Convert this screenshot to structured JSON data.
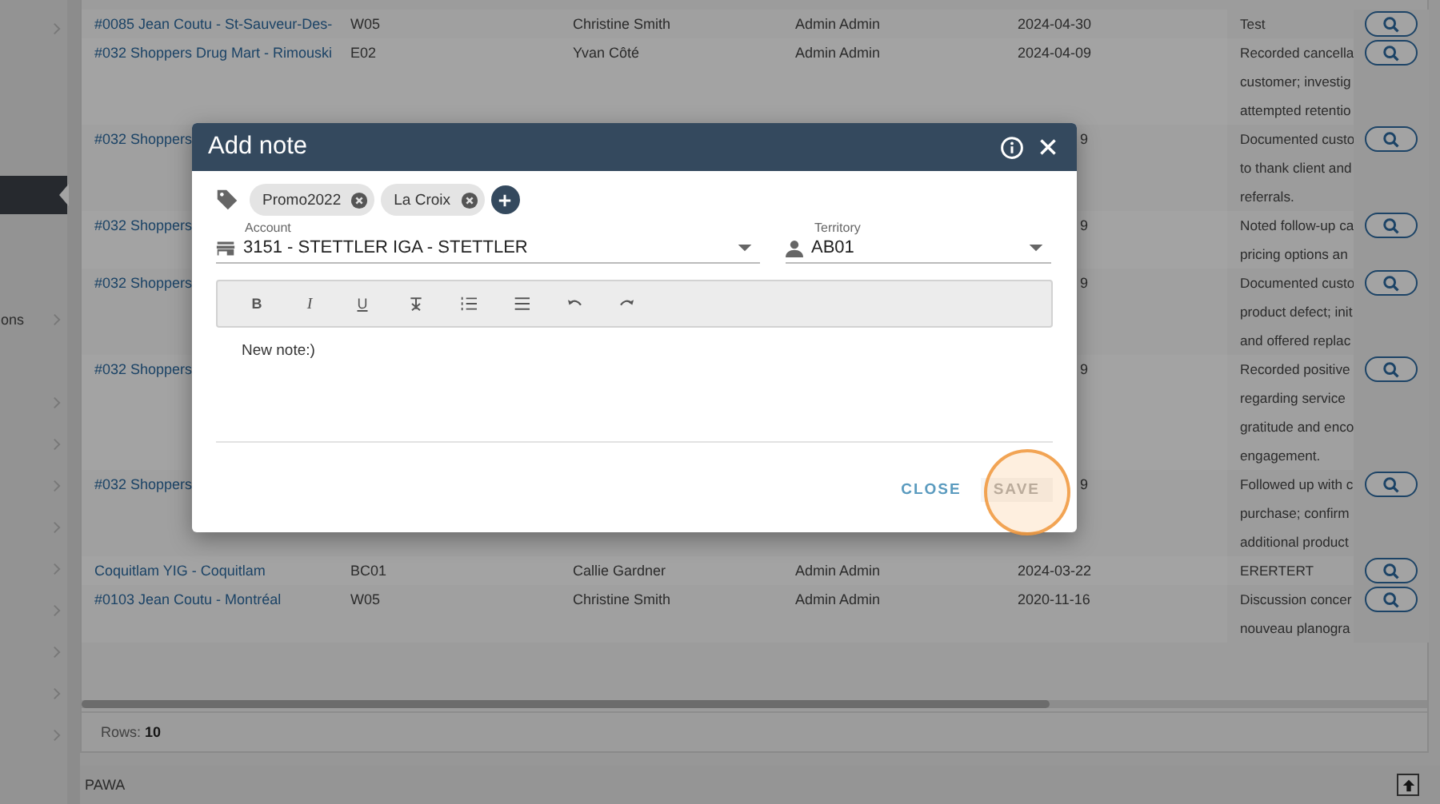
{
  "sidebar": {
    "items": [
      {
        "chevron": true,
        "selected": false
      },
      {
        "chevron": false,
        "selected": false
      },
      {
        "chevron": false,
        "selected": false
      },
      {
        "chevron": false,
        "selected": false
      },
      {
        "chevron": false,
        "selected": true
      },
      {
        "chevron": false,
        "selected": false
      },
      {
        "chevron": false,
        "selected": false
      },
      {
        "label": "ons",
        "chevron": true,
        "selected": false
      },
      {
        "chevron": false,
        "selected": false
      },
      {
        "chevron": true,
        "selected": false
      },
      {
        "chevron": true,
        "selected": false
      },
      {
        "chevron": true,
        "selected": false
      },
      {
        "chevron": true,
        "selected": false
      },
      {
        "chevron": true,
        "selected": false
      },
      {
        "chevron": true,
        "selected": false
      },
      {
        "chevron": true,
        "selected": false
      },
      {
        "chevron": true,
        "selected": false
      },
      {
        "chevron": true,
        "selected": false
      }
    ]
  },
  "table": {
    "rows": [
      {
        "kind": "full",
        "account": "#0085 Jean Coutu - St-Sauveur-Des-",
        "territory": "W05",
        "rep": "Christine Smith",
        "created_by": "Admin Admin",
        "date": "2024-04-30",
        "note": [
          "Test"
        ]
      },
      {
        "kind": "full",
        "account": "#032 Shoppers Drug Mart - Rimouski",
        "territory": "E02",
        "rep": "Yvan Côté",
        "created_by": "Admin Admin",
        "date": "2024-04-09",
        "note": [
          "Recorded cancella",
          "customer; investig",
          "attempted retentio"
        ]
      },
      {
        "kind": "covered",
        "account": "#032 Shoppers",
        "date": "9",
        "note": [
          "Documented custo",
          "to thank client and",
          "referrals."
        ]
      },
      {
        "kind": "covered",
        "account": "#032 Shoppers",
        "date": "9",
        "note": [
          "Noted follow-up ca",
          "pricing options an"
        ]
      },
      {
        "kind": "covered",
        "account": "#032 Shoppers",
        "date": "9",
        "note": [
          "Documented custo",
          "product defect; init",
          "and offered replac"
        ]
      },
      {
        "kind": "covered",
        "account": "#032 Shoppers",
        "date": "9",
        "note": [
          "Recorded positive",
          "regarding service",
          "gratitude and enco",
          "engagement."
        ]
      },
      {
        "kind": "covered",
        "account": "#032 Shoppers",
        "date": "9",
        "note": [
          "Followed up with c",
          "purchase; confirm",
          "additional product"
        ]
      },
      {
        "kind": "full",
        "account": "Coquitlam YIG - Coquitlam",
        "territory": "BC01",
        "rep": "Callie Gardner",
        "created_by": "Admin Admin",
        "date": "2024-03-22",
        "note": [
          "ERERTERT"
        ]
      },
      {
        "kind": "full",
        "account": "#0103 Jean Coutu - Montréal",
        "territory": "W05",
        "rep": "Christine Smith",
        "created_by": "Admin Admin",
        "date": "2020-11-16",
        "note": [
          "Discussion concer",
          "nouveau planogra"
        ]
      }
    ],
    "rows_label": "Rows:",
    "rows_count": "10"
  },
  "status_bar": {
    "text": "PAWA"
  },
  "modal": {
    "title": "Add note",
    "tags": [
      "Promo2022",
      "La Croix"
    ],
    "account": {
      "label": "Account",
      "value": "3151 - STETTLER IGA - STETTLER"
    },
    "territory": {
      "label": "Territory",
      "value": "AB01"
    },
    "toolbar": [
      {
        "kind": "bold",
        "label": "B"
      },
      {
        "kind": "italic",
        "label": "I"
      },
      {
        "kind": "underline",
        "label": "U"
      },
      {
        "kind": "clear-format"
      },
      {
        "kind": "ordered-list"
      },
      {
        "kind": "bullet-list"
      },
      {
        "kind": "undo"
      },
      {
        "kind": "redo"
      }
    ],
    "body": "New note:)",
    "buttons": [
      {
        "label": "CLOSE",
        "disabled": false
      },
      {
        "label": "SAVE",
        "disabled": true
      }
    ]
  }
}
